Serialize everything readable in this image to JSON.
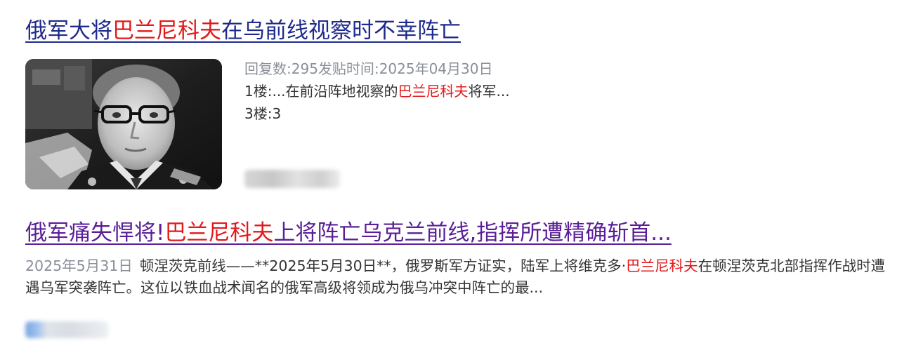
{
  "results": [
    {
      "title_pre": "俄军大将",
      "title_hl": "巴兰尼科夫",
      "title_post": "在乌前线视察时不幸阵亡",
      "thumbnail": "portrait-photo",
      "meta": {
        "replies_label": "回复数: ",
        "replies_value": "295",
        "post_time_label": " 发贴时间: ",
        "post_time_value": "2025年04月30日"
      },
      "floors": [
        {
          "label": "1楼: ",
          "text_pre": "...在前沿阵地视察的",
          "text_hl": "巴兰尼科夫",
          "text_post": "将军..."
        },
        {
          "label": "3楼: ",
          "text_pre": "3",
          "text_hl": "",
          "text_post": ""
        }
      ]
    },
    {
      "title_pre": "俄军痛失悍将!",
      "title_hl": "巴兰尼科夫",
      "title_post": "上将阵亡乌克兰前线,指挥所遭精确斩首...",
      "date": "2025年5月31日",
      "snippet_pre": "顿涅茨克前线——**2025年5月30日**，俄罗斯军方证实，陆军上将维克多·",
      "snippet_hl": "巴兰尼科夫",
      "snippet_post": "在顿涅茨克北部指挥作战时遭遇乌军突袭阵亡。这位以铁血战术闻名的俄军高级将领成为俄乌冲突中阵亡的最..."
    }
  ],
  "colors": {
    "highlight": "#e2191b",
    "title_link": "#1e2a8c",
    "visited_link": "#5a1f98",
    "meta_grey": "#8a8f99"
  }
}
